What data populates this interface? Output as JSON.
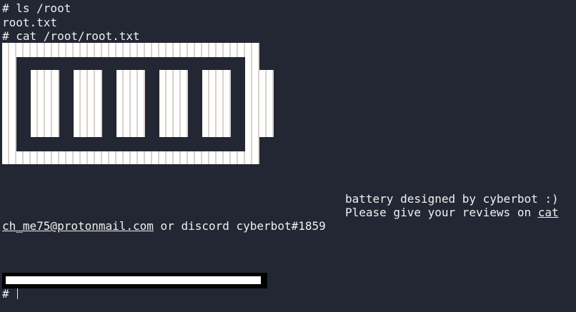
{
  "terminal": {
    "lines": [
      "# ls /root",
      "root.txt",
      "# cat /root/root.txt"
    ],
    "art_caption": "battery designed by cyberbot :)",
    "review_prefix": "Please give your reviews on ",
    "email_start": "cat",
    "email_rest": "ch_me75@protonmail.com",
    "review_suffix": " or discord cyberbot#1859",
    "prompt": "# ",
    "battery_cells": 5,
    "progress_fraction": 0.99,
    "colors": {
      "background": "#232733",
      "foreground": "#f0f0f0",
      "art": "#ffffff"
    }
  }
}
